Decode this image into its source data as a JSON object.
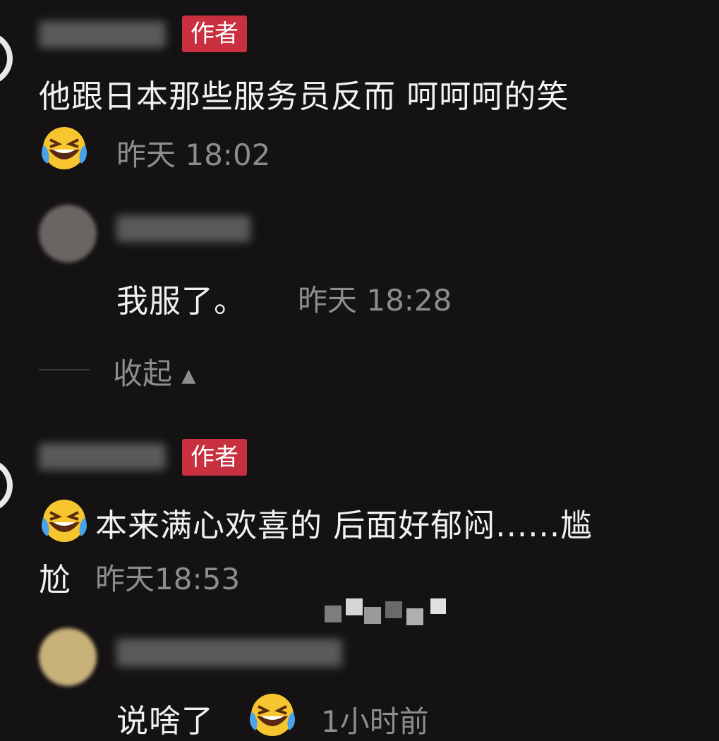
{
  "comments": [
    {
      "badge": "作者",
      "text": "他跟日本那些服务员反而 呵呵呵的笑",
      "time": "昨天 18:02"
    },
    {
      "text": "我服了。",
      "time": "昨天 18:28"
    },
    {
      "badge": "作者",
      "text_line1": "本来满心欢喜的 后面好郁闷......尴",
      "text_line2": "尬",
      "time": "昨天18:53"
    },
    {
      "text": "说啥了",
      "time": "1小时前"
    }
  ],
  "collapse_label": "收起",
  "colors": {
    "background": "#141213",
    "badge": "#c8303f",
    "text": "#f1f1f1",
    "muted": "#8d8d8d"
  },
  "icons": {
    "emoji": "laughing-crying-emoji-icon",
    "collapse": "triangle-up-icon"
  }
}
